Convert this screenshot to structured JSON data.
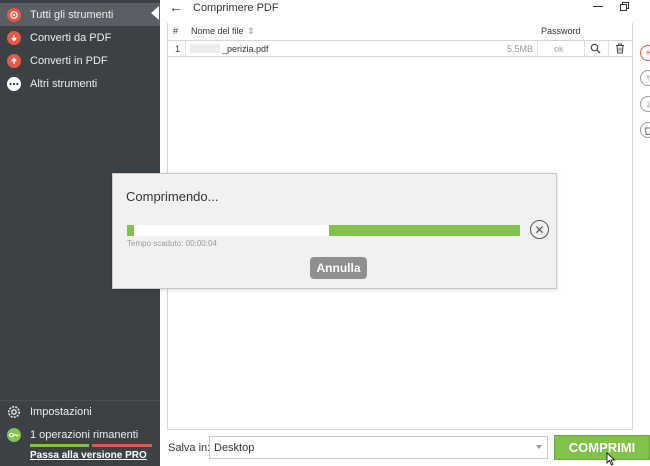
{
  "sidebar": {
    "items": [
      {
        "label": "Tutti gli strumenti",
        "icon": "all-tools-icon",
        "color": "#e15a4a"
      },
      {
        "label": "Converti da PDF",
        "icon": "convert-from-pdf-icon",
        "color": "#e15a4a"
      },
      {
        "label": "Converti in PDF",
        "icon": "convert-to-pdf-icon",
        "color": "#e15a4a"
      },
      {
        "label": "Altri strumenti",
        "icon": "more-tools-icon",
        "color": "#ffffff"
      }
    ],
    "settings_label": "Impostazioni",
    "ops_label": "1 operazioni rimanenti",
    "pro_link": "Passa alla versione PRO"
  },
  "header": {
    "title": "Comprimere PDF"
  },
  "table": {
    "columns": {
      "num": "#",
      "name": "Nome del file",
      "password": "Password"
    },
    "rows": [
      {
        "num": "1",
        "name": "_perizia.pdf",
        "size": "5.5MB",
        "password": "ok"
      }
    ]
  },
  "dialog": {
    "title": "Comprimendo...",
    "elapsed": "Tempo scaduto: 00:00:04",
    "cancel_label": "Annulla"
  },
  "footer": {
    "save_label": "Salva in:",
    "save_value": "Desktop",
    "compress_label": "COMPRIMI"
  },
  "colors": {
    "sidebar_bg": "#3c4146",
    "accent_green": "#7fc34a",
    "accent_red": "#e15a4a"
  }
}
